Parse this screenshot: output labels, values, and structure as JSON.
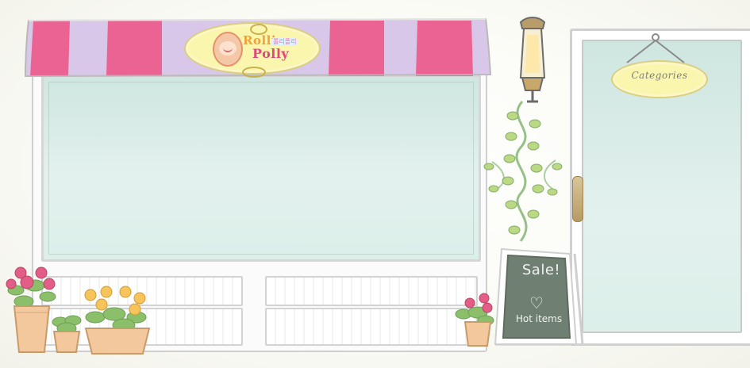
{
  "store": {
    "logo_line1": "Rolli",
    "logo_tag": "롤리폴리",
    "logo_line2": "Polly"
  },
  "door_sign": {
    "label": "Categories"
  },
  "chalkboard": {
    "line1": "Sale!",
    "heart": "♡",
    "line2": "Hot items"
  },
  "colors": {
    "awning_pink": "#ec5e8e",
    "awning_lavender": "#d8c7e8",
    "glass": "#d6ece7",
    "sign_yellow": "#fbf6ae",
    "chalkboard": "#6f7f71"
  },
  "icons": {
    "lamp": "wall-lamp-icon",
    "flowers": "flower-pot-icon",
    "heart": "heart-icon"
  }
}
